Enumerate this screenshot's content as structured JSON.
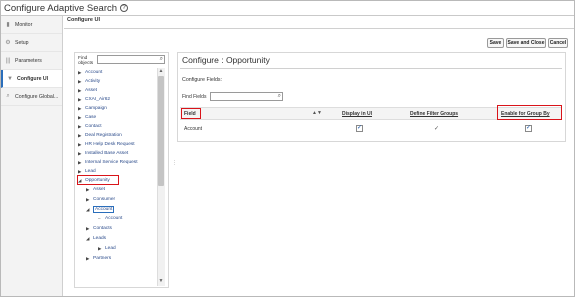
{
  "app": {
    "title": "Configure Adaptive Search"
  },
  "sidebar": {
    "items": [
      {
        "label": "Monitor",
        "icon": "bar-chart-icon"
      },
      {
        "label": "Setup",
        "icon": "gears-icon"
      },
      {
        "label": "Parameters",
        "icon": "columns-icon"
      },
      {
        "label": "Configure UI",
        "icon": "funnel-icon",
        "active": true
      },
      {
        "label": "Configure Global...",
        "icon": "search-icon"
      }
    ]
  },
  "tabs": {
    "active": "Configure UI"
  },
  "toolbar": {
    "save": "Save",
    "save_close": "Save and Close",
    "cancel": "Cancel"
  },
  "tree_panel": {
    "find_label": "Find objects",
    "find_value": "",
    "items": [
      {
        "label": "Account",
        "level": 0,
        "expanded": false
      },
      {
        "label": "Activity",
        "level": 0,
        "expanded": false
      },
      {
        "label": "Asset",
        "level": 0,
        "expanded": false
      },
      {
        "label": "CXAI_Air62",
        "level": 0,
        "expanded": false
      },
      {
        "label": "Campaign",
        "level": 0,
        "expanded": false
      },
      {
        "label": "Case",
        "level": 0,
        "expanded": false
      },
      {
        "label": "Contact",
        "level": 0,
        "expanded": false
      },
      {
        "label": "Deal Registration",
        "level": 0,
        "expanded": false
      },
      {
        "label": "HR Help Desk Request",
        "level": 0,
        "expanded": false
      },
      {
        "label": "Installed Base Asset",
        "level": 0,
        "expanded": false
      },
      {
        "label": "Internal Service Request",
        "level": 0,
        "expanded": false
      },
      {
        "label": "Lead",
        "level": 0,
        "expanded": false
      },
      {
        "label": "Opportunity",
        "level": 0,
        "expanded": true,
        "highlighted": true
      },
      {
        "label": "Asset",
        "level": 1,
        "expanded": false
      },
      {
        "label": "Consumer",
        "level": 1,
        "expanded": false
      },
      {
        "label": "Account",
        "level": 1,
        "expanded": true,
        "selected": true
      },
      {
        "label": "Account",
        "level": 2,
        "leaf": true
      },
      {
        "label": "Contacts",
        "level": 1,
        "expanded": false
      },
      {
        "label": "Leads",
        "level": 1,
        "expanded": true
      },
      {
        "label": "Lead",
        "level": 2,
        "expanded": false
      },
      {
        "label": "Partners",
        "level": 1,
        "expanded": false
      }
    ]
  },
  "content": {
    "title": "Configure : Opportunity",
    "subtitle": "Configure Fields:",
    "find_fields_label": "Find Fields",
    "find_fields_value": "",
    "columns": {
      "field": "Field",
      "display_in_ui": "Display in UI",
      "define_filter_groups": "Define Filter Groups",
      "enable_group_by": "Enable for Group By"
    },
    "rows": [
      {
        "field": "Account",
        "display_in_ui": true,
        "define_filter_groups": true,
        "enable_group_by": true
      }
    ]
  },
  "colors": {
    "highlight_red": "#d9141a",
    "link_blue": "#2a4a8a",
    "check_blue": "#1c58a8"
  }
}
